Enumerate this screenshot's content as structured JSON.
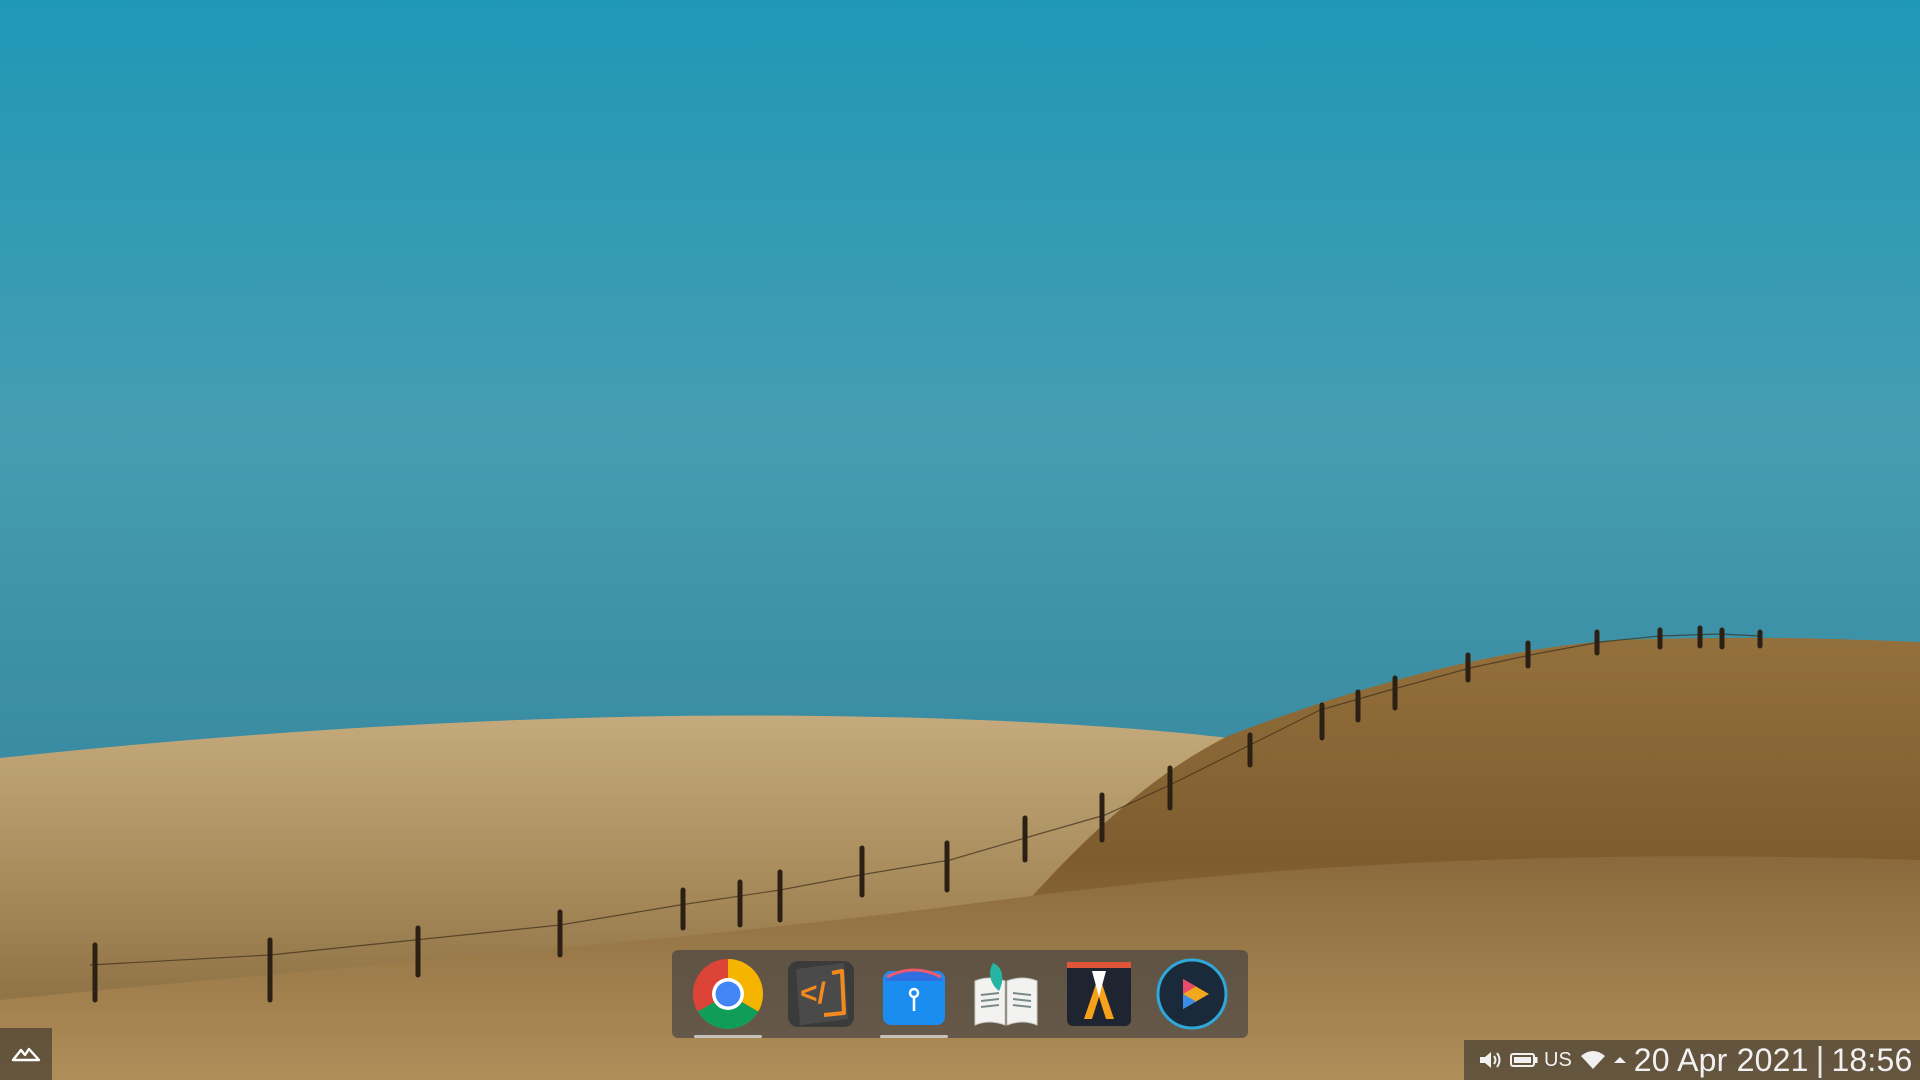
{
  "dock": {
    "apps": [
      {
        "name": "Google Chrome",
        "icon": "chrome-icon",
        "running": true
      },
      {
        "name": "Code Editor",
        "icon": "code-editor-icon",
        "running": false
      },
      {
        "name": "Package Manager",
        "icon": "package-icon",
        "running": true
      },
      {
        "name": "Reader",
        "icon": "book-reader-icon",
        "running": false
      },
      {
        "name": "Inkscape-like Vector Editor",
        "icon": "vector-editor-icon",
        "running": false
      },
      {
        "name": "Media Player",
        "icon": "media-player-icon",
        "running": false
      }
    ]
  },
  "tray": {
    "keyboard_layout": "US",
    "date": "20 Apr 2021",
    "separator": "|",
    "time": "18:56"
  },
  "colors": {
    "sky_top": "#1f98b6",
    "sky_bottom": "#3a8fa3",
    "field": "#a98e5f",
    "hill": "#8c6a3a"
  }
}
